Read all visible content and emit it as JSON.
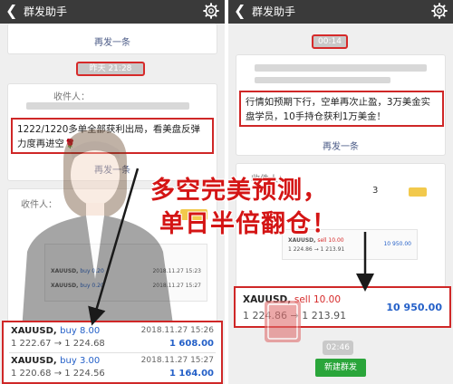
{
  "left": {
    "header": {
      "back_glyph": "❮",
      "title": "群发助手",
      "settings_icon": "gear-icon"
    },
    "resend_top": "再发一条",
    "time_pill": "昨天 21:28",
    "receivers_label": "收件人：",
    "message": "1222/1220多单全部获利出局，看美盘反弹力度再进空",
    "message_emoji": "🌹",
    "resend_mid": "再发一条",
    "receivers_label_2": "收件人：",
    "screenshot_rows": [
      {
        "symbol": "XAUUSD,",
        "side": "buy 0.20",
        "time": "2018.11.27 15:23"
      },
      {
        "symbol": "XAUUSD,",
        "side": "buy 0.20",
        "time": "2018.11.27 15:27"
      }
    ],
    "trades": [
      {
        "symbol": "XAUUSD,",
        "side": "buy 8.00",
        "prices": "1 222.67 → 1 224.68",
        "datetime": "2018.11.27 15:26",
        "profit": "1 608.00"
      },
      {
        "symbol": "XAUUSD,",
        "side": "buy 3.00",
        "prices": "1 220.68 → 1 224.56",
        "datetime": "2018.11.27 15:27",
        "profit": "1 164.00"
      }
    ]
  },
  "right": {
    "header": {
      "back_glyph": "❮",
      "title": "群发助手",
      "settings_icon": "gear-icon"
    },
    "time_pill": "00:14",
    "message": "行情如预期下行，空单再次止盈，3万美金实盘学员，10手持仓获利1万美金！",
    "resend": "再发一条",
    "receivers_label": "收件人：",
    "counter": "3",
    "mini_trade": {
      "symbol": "XAUUSD,",
      "side": "sell 10.00",
      "prices": "1 224.86 → 1 213.91",
      "profit": "10 950.00"
    },
    "trade": {
      "symbol": "XAUUSD,",
      "side": "sell 10.00",
      "prices": "1 224.86 → 1 213.91",
      "profit": "10 950.00"
    },
    "time_pill_2": "02:46",
    "new_broadcast_button": "新建群发"
  },
  "overlay": {
    "line1": "多空完美预测，",
    "line2": "单日半倍翻仓！"
  },
  "colors": {
    "header_bg": "#3a3a3a",
    "highlight_red": "#cf2727",
    "overlay_red": "#d41515",
    "link_blue": "#4a5a86",
    "profit_blue": "#2460c8",
    "green_button": "#2aa53a"
  }
}
